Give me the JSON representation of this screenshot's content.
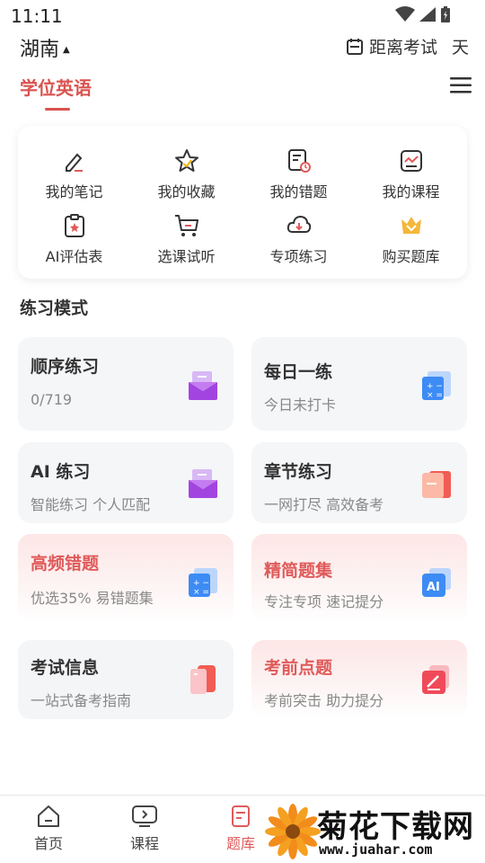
{
  "status_bar": {
    "time": "11:11"
  },
  "header": {
    "location": "湖南",
    "exam_countdown_label": "距离考试",
    "exam_countdown_unit": "天"
  },
  "tabs": {
    "active": "学位英语"
  },
  "quick_links": [
    {
      "label": "我的笔记",
      "icon": "note-icon"
    },
    {
      "label": "我的收藏",
      "icon": "star-icon"
    },
    {
      "label": "我的错题",
      "icon": "wrong-questions-icon"
    },
    {
      "label": "我的课程",
      "icon": "course-icon"
    },
    {
      "label": "AI评估表",
      "icon": "assessment-icon"
    },
    {
      "label": "选课试听",
      "icon": "cart-icon"
    },
    {
      "label": "专项练习",
      "icon": "special-practice-icon"
    },
    {
      "label": "购买题库",
      "icon": "crown-icon"
    }
  ],
  "section_title": "练习模式",
  "modes": [
    {
      "title": "顺序练习",
      "sub": "0/719"
    },
    {
      "title": "每日一练",
      "sub": "今日未打卡"
    },
    {
      "title": "AI 练习",
      "sub": "智能练习 个人匹配"
    },
    {
      "title": "章节练习",
      "sub": "一网打尽 高效备考"
    },
    {
      "title": "高频错题",
      "sub": "优选35% 易错题集"
    },
    {
      "title": "精简题集",
      "sub": "专注专项 速记提分"
    },
    {
      "title": "考试信息",
      "sub": "一站式备考指南"
    },
    {
      "title": "考前点题",
      "sub": "考前突击 助力提分"
    }
  ],
  "bottom_nav": [
    {
      "label": "首页"
    },
    {
      "label": "课程"
    },
    {
      "label": "题库"
    }
  ],
  "watermark": {
    "title": "菊花下载网",
    "url": "www.juahar.com"
  },
  "colors": {
    "accent": "#d9534f",
    "purple": "#9b3fd6",
    "blue": "#3d8bf5",
    "red": "#f25c54"
  }
}
